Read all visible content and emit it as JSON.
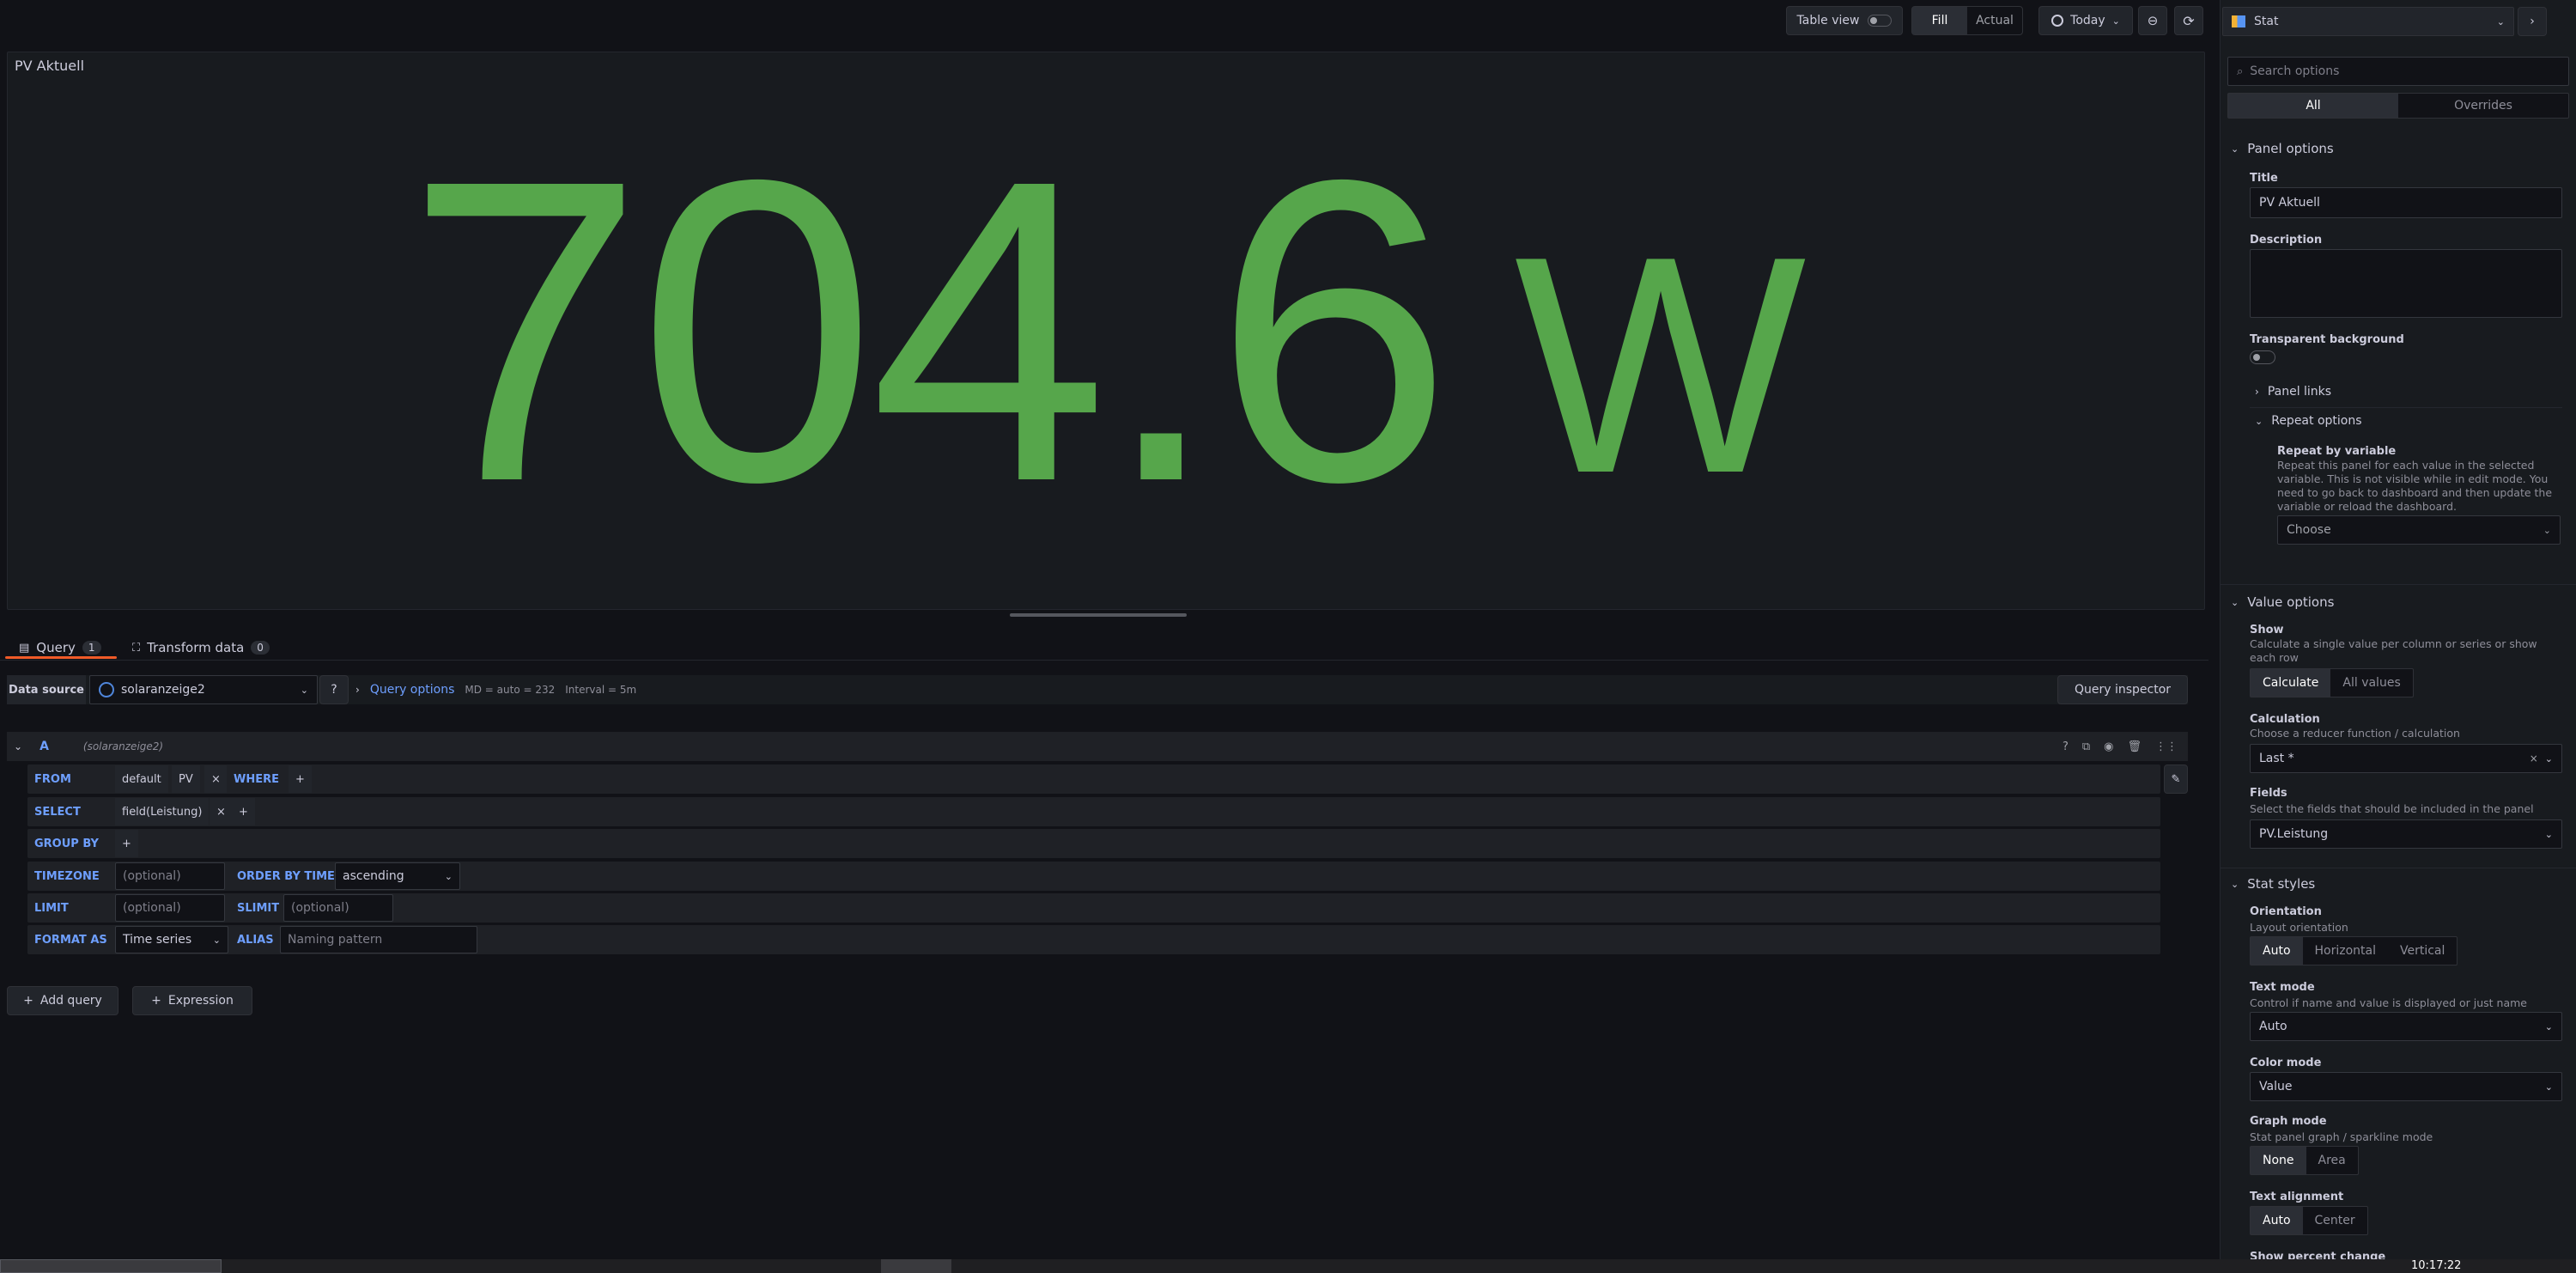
{
  "toolbar": {
    "table_view_label": "Table view",
    "fill_label": "Fill",
    "actual_label": "Actual",
    "time_range_label": "Today"
  },
  "panel": {
    "title": "PV Aktuell",
    "value": "704.6",
    "unit": "W",
    "value_color": "#56a64b"
  },
  "query_tabs": {
    "query_label": "Query",
    "query_count": "1",
    "transform_label": "Transform data",
    "transform_count": "0"
  },
  "datasource_bar": {
    "label": "Data source",
    "value": "solaranzeige2",
    "query_options_label": "Query options",
    "md_info": "MD = auto = 232",
    "interval_info": "Interval = 5m",
    "inspector_label": "Query inspector"
  },
  "query": {
    "ref_id": "A",
    "datasource_hint": "(solaranzeige2)",
    "from_kw": "FROM",
    "from_policy": "default",
    "from_measurement": "PV",
    "where_kw": "WHERE",
    "select_kw": "SELECT",
    "select_field": "field(Leistung)",
    "group_by_kw": "GROUP BY",
    "timezone_kw": "TIMEZONE",
    "timezone_placeholder": "(optional)",
    "order_kw": "ORDER BY TIME",
    "order_value": "ascending",
    "limit_kw": "LIMIT",
    "limit_placeholder": "(optional)",
    "slimit_kw": "SLIMIT",
    "slimit_placeholder": "(optional)",
    "format_kw": "FORMAT AS",
    "format_value": "Time series",
    "alias_kw": "ALIAS",
    "alias_placeholder": "Naming pattern",
    "plus": "+",
    "x": "×"
  },
  "bottom_buttons": {
    "add_query": "Add query",
    "expression": "Expression"
  },
  "sidebar": {
    "viz_name": "Stat",
    "search_placeholder": "Search options",
    "tab_all": "All",
    "tab_overrides": "Overrides",
    "panel_options": {
      "header": "Panel options",
      "title_label": "Title",
      "title_value": "PV Aktuell",
      "description_label": "Description",
      "transparent_label": "Transparent background",
      "links_label": "Panel links",
      "repeat_label": "Repeat options",
      "repeat_by_label": "Repeat by variable",
      "repeat_desc": "Repeat this panel for each value in the selected variable. This is not visible while in edit mode. You need to go back to dashboard and then update the variable or reload the dashboard.",
      "repeat_placeholder": "Choose"
    },
    "value_options": {
      "header": "Value options",
      "show_label": "Show",
      "show_desc": "Calculate a single value per column or series or show each row",
      "show_calculate": "Calculate",
      "show_all": "All values",
      "calc_label": "Calculation",
      "calc_desc": "Choose a reducer function / calculation",
      "calc_value": "Last *",
      "fields_label": "Fields",
      "fields_desc": "Select the fields that should be included in the panel",
      "fields_value": "PV.Leistung"
    },
    "stat_styles": {
      "header": "Stat styles",
      "orientation_label": "Orientation",
      "orientation_desc": "Layout orientation",
      "orient_auto": "Auto",
      "orient_h": "Horizontal",
      "orient_v": "Vertical",
      "text_mode_label": "Text mode",
      "text_mode_desc": "Control if name and value is displayed or just name",
      "text_mode_value": "Auto",
      "color_mode_label": "Color mode",
      "color_mode_value": "Value",
      "graph_mode_label": "Graph mode",
      "graph_mode_desc": "Stat panel graph / sparkline mode",
      "graph_none": "None",
      "graph_area": "Area",
      "text_align_label": "Text alignment",
      "align_auto": "Auto",
      "align_center": "Center",
      "percent_label": "Show percent change"
    }
  },
  "taskbar": {
    "clock": "10:17:22"
  }
}
